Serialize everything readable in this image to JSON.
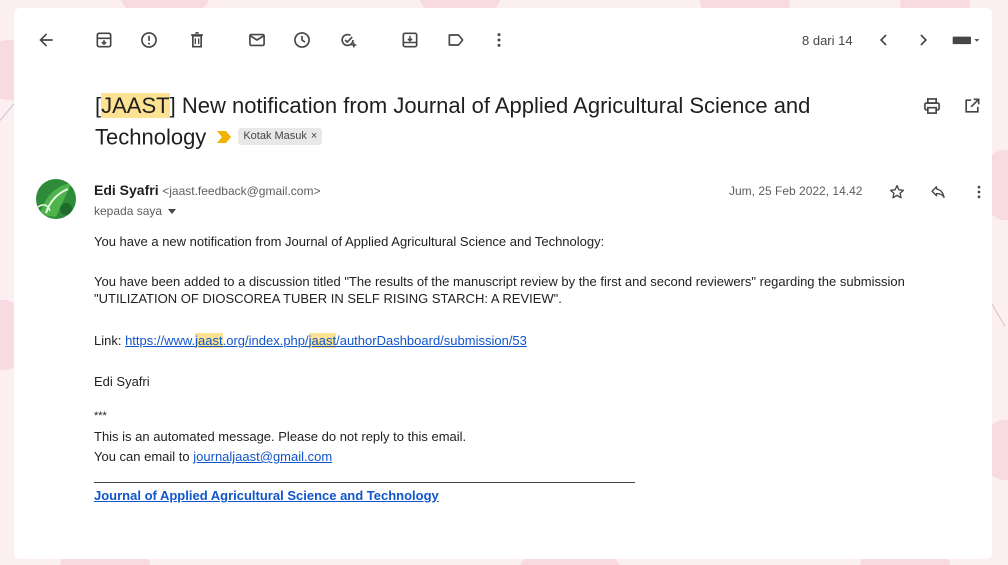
{
  "toolbar": {
    "back_icon": "arrow-left-icon",
    "archive_icon": "archive-icon",
    "report_icon": "report-spam-icon",
    "delete_icon": "trash-icon",
    "unread_icon": "mail-icon",
    "snooze_icon": "clock-icon",
    "task_icon": "add-task-icon",
    "move_icon": "move-to-icon",
    "label_icon": "label-icon",
    "more_icon": "more-vertical-icon",
    "pager": "8 dari 14",
    "prev_icon": "chevron-left-icon",
    "next_icon": "chevron-right-icon",
    "keyboard_icon": "keyboard-icon"
  },
  "subject": {
    "tag": "JAAST",
    "bracket_open": "[",
    "bracket_close": "]",
    "title_line1": " New notification from Journal of Applied Agricultural Science and",
    "title_line2": "Technology",
    "label": "Kotak Masuk",
    "label_close": "×",
    "print_icon": "print-icon",
    "open_new_icon": "open-in-new-icon"
  },
  "message": {
    "sender_name": "Edi Syafri",
    "sender_email": "<jaast.feedback@gmail.com>",
    "recipient": "kepada saya",
    "date": "Jum, 25 Feb 2022, 14.42",
    "star_icon": "star-icon",
    "reply_icon": "reply-icon",
    "more_icon": "more-vertical-icon"
  },
  "body": {
    "line1": "You have a new notification from Journal of Applied Agricultural Science and Technology:",
    "line2a": "You have been added to a discussion titled \"The results of the manuscript review by the first and second reviewers\" regarding the submission",
    "line2b": "\"UTILIZATION OF DIOSCOREA TUBER IN SELF RISING STARCH: A REVIEW\".",
    "link_label": "Link: ",
    "link_part1": "https://www.",
    "link_hl1": "jaast",
    "link_part2": ".org/index.php/",
    "link_hl2": "jaast",
    "link_part3": "/authorDashboard/submission/53",
    "signature": "Edi Syafri",
    "stars": "***",
    "auto_msg": "This is an automated message. Please do not reply to this email.",
    "contact_prefix": "You can email to ",
    "contact_email": "journaljaast@gmail.com",
    "footer": "Journal of Applied Agricultural Science and Technology"
  },
  "colors": {
    "highlight": "#fde293",
    "link": "#1155cc",
    "importance": "#f2b300"
  }
}
